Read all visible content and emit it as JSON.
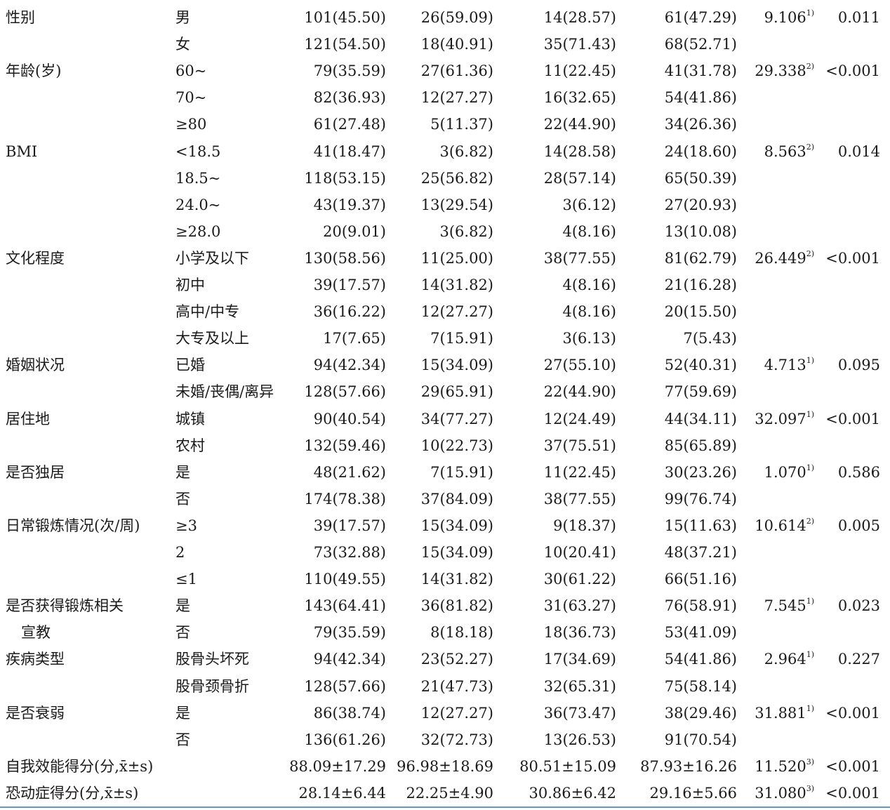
{
  "rows": [
    {
      "var": "性别",
      "cat": "男",
      "total": "101(45.50)",
      "g1": "26(59.09)",
      "g2": "14(28.57)",
      "g3": "61(47.29)",
      "stat": "9.106",
      "sup": "1)",
      "p": "0.011"
    },
    {
      "var": "",
      "cat": "女",
      "total": "121(54.50)",
      "g1": "18(40.91)",
      "g2": "35(71.43)",
      "g3": "68(52.71)",
      "stat": "",
      "sup": "",
      "p": ""
    },
    {
      "var": "年龄(岁)",
      "cat": "60~",
      "total": "79(35.59)",
      "g1": "27(61.36)",
      "g2": "11(22.45)",
      "g3": "41(31.78)",
      "stat": "29.338",
      "sup": "2)",
      "p": "<0.001"
    },
    {
      "var": "",
      "cat": "70~",
      "total": "82(36.93)",
      "g1": "12(27.27)",
      "g2": "16(32.65)",
      "g3": "54(41.86)",
      "stat": "",
      "sup": "",
      "p": ""
    },
    {
      "var": "",
      "cat": "≥80",
      "total": "61(27.48)",
      "g1": "5(11.37)",
      "g2": "22(44.90)",
      "g3": "34(26.36)",
      "stat": "",
      "sup": "",
      "p": ""
    },
    {
      "var": "BMI",
      "cat": "<18.5",
      "total": "41(18.47)",
      "g1": "3(6.82)",
      "g2": "14(28.58)",
      "g3": "24(18.60)",
      "stat": "8.563",
      "sup": "2)",
      "p": "0.014"
    },
    {
      "var": "",
      "cat": "18.5~",
      "total": "118(53.15)",
      "g1": "25(56.82)",
      "g2": "28(57.14)",
      "g3": "65(50.39)",
      "stat": "",
      "sup": "",
      "p": ""
    },
    {
      "var": "",
      "cat": "24.0~",
      "total": "43(19.37)",
      "g1": "13(29.54)",
      "g2": "3(6.12)",
      "g3": "27(20.93)",
      "stat": "",
      "sup": "",
      "p": ""
    },
    {
      "var": "",
      "cat": "≥28.0",
      "total": "20(9.01)",
      "g1": "3(6.82)",
      "g2": "4(8.16)",
      "g3": "13(10.08)",
      "stat": "",
      "sup": "",
      "p": ""
    },
    {
      "var": "文化程度",
      "cat": "小学及以下",
      "total": "130(58.56)",
      "g1": "11(25.00)",
      "g2": "38(77.55)",
      "g3": "81(62.79)",
      "stat": "26.449",
      "sup": "2)",
      "p": "<0.001"
    },
    {
      "var": "",
      "cat": "初中",
      "total": "39(17.57)",
      "g1": "14(31.82)",
      "g2": "4(8.16)",
      "g3": "21(16.28)",
      "stat": "",
      "sup": "",
      "p": ""
    },
    {
      "var": "",
      "cat": "高中/中专",
      "total": "36(16.22)",
      "g1": "12(27.27)",
      "g2": "4(8.16)",
      "g3": "20(15.50)",
      "stat": "",
      "sup": "",
      "p": ""
    },
    {
      "var": "",
      "cat": "大专及以上",
      "total": "17(7.65)",
      "g1": "7(15.91)",
      "g2": "3(6.13)",
      "g3": "7(5.43)",
      "stat": "",
      "sup": "",
      "p": ""
    },
    {
      "var": "婚姻状况",
      "cat": "已婚",
      "total": "94(42.34)",
      "g1": "15(34.09)",
      "g2": "27(55.10)",
      "g3": "52(40.31)",
      "stat": "4.713",
      "sup": "1)",
      "p": "0.095"
    },
    {
      "var": "",
      "cat": "未婚/丧偶/离异",
      "total": "128(57.66)",
      "g1": "29(65.91)",
      "g2": "22(44.90)",
      "g3": "77(59.69)",
      "stat": "",
      "sup": "",
      "p": ""
    },
    {
      "var": "居住地",
      "cat": "城镇",
      "total": "90(40.54)",
      "g1": "34(77.27)",
      "g2": "12(24.49)",
      "g3": "44(34.11)",
      "stat": "32.097",
      "sup": "1)",
      "p": "<0.001"
    },
    {
      "var": "",
      "cat": "农村",
      "total": "132(59.46)",
      "g1": "10(22.73)",
      "g2": "37(75.51)",
      "g3": "85(65.89)",
      "stat": "",
      "sup": "",
      "p": ""
    },
    {
      "var": "是否独居",
      "cat": "是",
      "total": "48(21.62)",
      "g1": "7(15.91)",
      "g2": "11(22.45)",
      "g3": "30(23.26)",
      "stat": "1.070",
      "sup": "1)",
      "p": "0.586"
    },
    {
      "var": "",
      "cat": "否",
      "total": "174(78.38)",
      "g1": "37(84.09)",
      "g2": "38(77.55)",
      "g3": "99(76.74)",
      "stat": "",
      "sup": "",
      "p": ""
    },
    {
      "var": "日常锻炼情况(次/周)",
      "cat": "≥3",
      "total": "39(17.57)",
      "g1": "15(34.09)",
      "g2": "9(18.37)",
      "g3": "15(11.63)",
      "stat": "10.614",
      "sup": "2)",
      "p": "0.005"
    },
    {
      "var": "",
      "cat": "2",
      "total": "73(32.88)",
      "g1": "15(34.09)",
      "g2": "10(20.41)",
      "g3": "48(37.21)",
      "stat": "",
      "sup": "",
      "p": ""
    },
    {
      "var": "",
      "cat": "≤1",
      "total": "110(49.55)",
      "g1": "14(31.82)",
      "g2": "30(61.22)",
      "g3": "66(51.16)",
      "stat": "",
      "sup": "",
      "p": ""
    },
    {
      "var": "是否获得锻炼相关",
      "cat": "是",
      "total": "143(64.41)",
      "g1": "36(81.82)",
      "g2": "31(63.27)",
      "g3": "76(58.91)",
      "stat": "7.545",
      "sup": "1)",
      "p": "0.023"
    },
    {
      "var": "宣教",
      "indent": true,
      "cat": "否",
      "total": "79(35.59)",
      "g1": "8(18.18)",
      "g2": "18(36.73)",
      "g3": "53(41.09)",
      "stat": "",
      "sup": "",
      "p": ""
    },
    {
      "var": "疾病类型",
      "cat": "股骨头坏死",
      "total": "94(42.34)",
      "g1": "23(52.27)",
      "g2": "17(34.69)",
      "g3": "54(41.86)",
      "stat": "2.964",
      "sup": "1)",
      "p": "0.227"
    },
    {
      "var": "",
      "cat": "股骨颈骨折",
      "total": "128(57.66)",
      "g1": "21(47.73)",
      "g2": "32(65.31)",
      "g3": "75(58.14)",
      "stat": "",
      "sup": "",
      "p": ""
    },
    {
      "var": "是否衰弱",
      "cat": "是",
      "total": "86(38.74)",
      "g1": "12(27.27)",
      "g2": "36(73.47)",
      "g3": "38(29.46)",
      "stat": "31.881",
      "sup": "1)",
      "p": "<0.001"
    },
    {
      "var": "",
      "cat": "否",
      "total": "136(61.26)",
      "g1": "32(72.73)",
      "g2": "13(26.53)",
      "g3": "91(70.54)",
      "stat": "",
      "sup": "",
      "p": ""
    },
    {
      "var": "自我效能得分(分,x̄±s)",
      "cat": "",
      "total": "88.09±17.29",
      "g1": "96.98±18.69",
      "g2": "80.51±15.09",
      "g3": "87.93±16.26",
      "stat": "11.520",
      "sup": "3)",
      "p": "<0.001"
    },
    {
      "var": "恐动症得分(分,x̄±s)",
      "cat": "",
      "total": "28.14±6.44",
      "g1": "22.25±4.90",
      "g2": "30.86±6.42",
      "g3": "29.16±5.66",
      "stat": "31.080",
      "sup": "3)",
      "p": "<0.001"
    }
  ]
}
